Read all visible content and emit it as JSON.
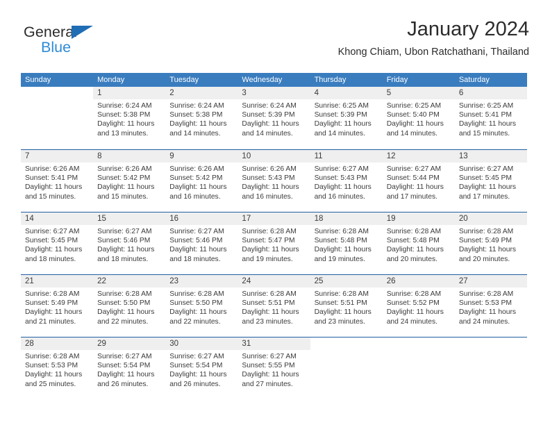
{
  "brand": {
    "name_primary": "General",
    "name_secondary": "Blue",
    "triangle_color": "#1f6db5",
    "secondary_color": "#2e8bd6"
  },
  "header": {
    "title": "January 2024",
    "subtitle": "Khong Chiam, Ubon Ratchathani, Thailand"
  },
  "colors": {
    "header_bar": "#3a7dbf",
    "row_divider": "#1f5fa0",
    "day_number_bg": "#efefef",
    "text": "#3a3a3a"
  },
  "weekdays": [
    "Sunday",
    "Monday",
    "Tuesday",
    "Wednesday",
    "Thursday",
    "Friday",
    "Saturday"
  ],
  "labels": {
    "sunrise_prefix": "Sunrise:",
    "sunset_prefix": "Sunset:",
    "daylight_prefix": "Daylight:"
  },
  "weeks": [
    [
      {
        "day": "",
        "empty": true
      },
      {
        "day": "1",
        "sunrise": "Sunrise: 6:24 AM",
        "sunset": "Sunset: 5:38 PM",
        "daylight": "Daylight: 11 hours and 13 minutes."
      },
      {
        "day": "2",
        "sunrise": "Sunrise: 6:24 AM",
        "sunset": "Sunset: 5:38 PM",
        "daylight": "Daylight: 11 hours and 14 minutes."
      },
      {
        "day": "3",
        "sunrise": "Sunrise: 6:24 AM",
        "sunset": "Sunset: 5:39 PM",
        "daylight": "Daylight: 11 hours and 14 minutes."
      },
      {
        "day": "4",
        "sunrise": "Sunrise: 6:25 AM",
        "sunset": "Sunset: 5:39 PM",
        "daylight": "Daylight: 11 hours and 14 minutes."
      },
      {
        "day": "5",
        "sunrise": "Sunrise: 6:25 AM",
        "sunset": "Sunset: 5:40 PM",
        "daylight": "Daylight: 11 hours and 14 minutes."
      },
      {
        "day": "6",
        "sunrise": "Sunrise: 6:25 AM",
        "sunset": "Sunset: 5:41 PM",
        "daylight": "Daylight: 11 hours and 15 minutes."
      }
    ],
    [
      {
        "day": "7",
        "sunrise": "Sunrise: 6:26 AM",
        "sunset": "Sunset: 5:41 PM",
        "daylight": "Daylight: 11 hours and 15 minutes."
      },
      {
        "day": "8",
        "sunrise": "Sunrise: 6:26 AM",
        "sunset": "Sunset: 5:42 PM",
        "daylight": "Daylight: 11 hours and 15 minutes."
      },
      {
        "day": "9",
        "sunrise": "Sunrise: 6:26 AM",
        "sunset": "Sunset: 5:42 PM",
        "daylight": "Daylight: 11 hours and 16 minutes."
      },
      {
        "day": "10",
        "sunrise": "Sunrise: 6:26 AM",
        "sunset": "Sunset: 5:43 PM",
        "daylight": "Daylight: 11 hours and 16 minutes."
      },
      {
        "day": "11",
        "sunrise": "Sunrise: 6:27 AM",
        "sunset": "Sunset: 5:43 PM",
        "daylight": "Daylight: 11 hours and 16 minutes."
      },
      {
        "day": "12",
        "sunrise": "Sunrise: 6:27 AM",
        "sunset": "Sunset: 5:44 PM",
        "daylight": "Daylight: 11 hours and 17 minutes."
      },
      {
        "day": "13",
        "sunrise": "Sunrise: 6:27 AM",
        "sunset": "Sunset: 5:45 PM",
        "daylight": "Daylight: 11 hours and 17 minutes."
      }
    ],
    [
      {
        "day": "14",
        "sunrise": "Sunrise: 6:27 AM",
        "sunset": "Sunset: 5:45 PM",
        "daylight": "Daylight: 11 hours and 18 minutes."
      },
      {
        "day": "15",
        "sunrise": "Sunrise: 6:27 AM",
        "sunset": "Sunset: 5:46 PM",
        "daylight": "Daylight: 11 hours and 18 minutes."
      },
      {
        "day": "16",
        "sunrise": "Sunrise: 6:27 AM",
        "sunset": "Sunset: 5:46 PM",
        "daylight": "Daylight: 11 hours and 18 minutes."
      },
      {
        "day": "17",
        "sunrise": "Sunrise: 6:28 AM",
        "sunset": "Sunset: 5:47 PM",
        "daylight": "Daylight: 11 hours and 19 minutes."
      },
      {
        "day": "18",
        "sunrise": "Sunrise: 6:28 AM",
        "sunset": "Sunset: 5:48 PM",
        "daylight": "Daylight: 11 hours and 19 minutes."
      },
      {
        "day": "19",
        "sunrise": "Sunrise: 6:28 AM",
        "sunset": "Sunset: 5:48 PM",
        "daylight": "Daylight: 11 hours and 20 minutes."
      },
      {
        "day": "20",
        "sunrise": "Sunrise: 6:28 AM",
        "sunset": "Sunset: 5:49 PM",
        "daylight": "Daylight: 11 hours and 20 minutes."
      }
    ],
    [
      {
        "day": "21",
        "sunrise": "Sunrise: 6:28 AM",
        "sunset": "Sunset: 5:49 PM",
        "daylight": "Daylight: 11 hours and 21 minutes."
      },
      {
        "day": "22",
        "sunrise": "Sunrise: 6:28 AM",
        "sunset": "Sunset: 5:50 PM",
        "daylight": "Daylight: 11 hours and 22 minutes."
      },
      {
        "day": "23",
        "sunrise": "Sunrise: 6:28 AM",
        "sunset": "Sunset: 5:50 PM",
        "daylight": "Daylight: 11 hours and 22 minutes."
      },
      {
        "day": "24",
        "sunrise": "Sunrise: 6:28 AM",
        "sunset": "Sunset: 5:51 PM",
        "daylight": "Daylight: 11 hours and 23 minutes."
      },
      {
        "day": "25",
        "sunrise": "Sunrise: 6:28 AM",
        "sunset": "Sunset: 5:51 PM",
        "daylight": "Daylight: 11 hours and 23 minutes."
      },
      {
        "day": "26",
        "sunrise": "Sunrise: 6:28 AM",
        "sunset": "Sunset: 5:52 PM",
        "daylight": "Daylight: 11 hours and 24 minutes."
      },
      {
        "day": "27",
        "sunrise": "Sunrise: 6:28 AM",
        "sunset": "Sunset: 5:53 PM",
        "daylight": "Daylight: 11 hours and 24 minutes."
      }
    ],
    [
      {
        "day": "28",
        "sunrise": "Sunrise: 6:28 AM",
        "sunset": "Sunset: 5:53 PM",
        "daylight": "Daylight: 11 hours and 25 minutes."
      },
      {
        "day": "29",
        "sunrise": "Sunrise: 6:27 AM",
        "sunset": "Sunset: 5:54 PM",
        "daylight": "Daylight: 11 hours and 26 minutes."
      },
      {
        "day": "30",
        "sunrise": "Sunrise: 6:27 AM",
        "sunset": "Sunset: 5:54 PM",
        "daylight": "Daylight: 11 hours and 26 minutes."
      },
      {
        "day": "31",
        "sunrise": "Sunrise: 6:27 AM",
        "sunset": "Sunset: 5:55 PM",
        "daylight": "Daylight: 11 hours and 27 minutes."
      },
      {
        "day": "",
        "empty": true
      },
      {
        "day": "",
        "empty": true
      },
      {
        "day": "",
        "empty": true
      }
    ]
  ]
}
